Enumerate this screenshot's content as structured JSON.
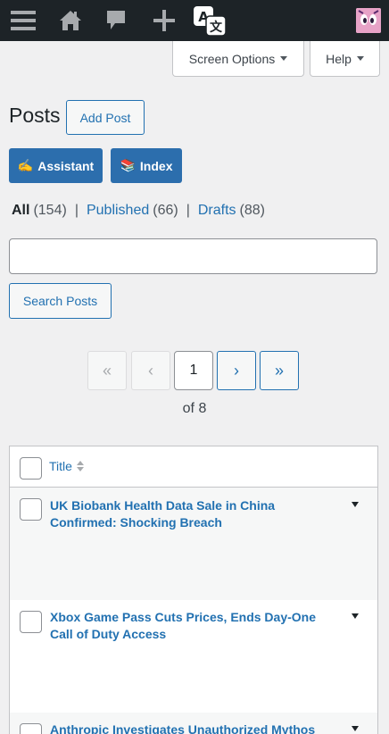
{
  "adminbar": {
    "icons": [
      "menu-icon",
      "home-icon",
      "comments-icon",
      "plus-icon",
      "translate-icon",
      "avatar"
    ]
  },
  "screen_meta": {
    "screen_options_label": "Screen Options",
    "help_label": "Help"
  },
  "page": {
    "title": "Posts",
    "add_post_label": "Add Post",
    "assistant_label": "Assistant",
    "assistant_emoji": "✍️",
    "index_label": "Index",
    "index_emoji": "📚"
  },
  "filters": {
    "all_label": "All",
    "all_count": "(154)",
    "published_label": "Published",
    "published_count": "(66)",
    "drafts_label": "Drafts",
    "drafts_count": "(88)",
    "separator": "|"
  },
  "search": {
    "value": "",
    "button_label": "Search Posts"
  },
  "pagination": {
    "first": "«",
    "prev": "‹",
    "current_page": "1",
    "next": "›",
    "last": "»",
    "of_text": "of 8"
  },
  "table": {
    "title_header": "Title",
    "rows": [
      {
        "title": "UK Biobank Health Data Sale in China Confirmed: Shocking Breach"
      },
      {
        "title": "Xbox Game Pass Cuts Prices, Ends Day-One Call of Duty Access"
      },
      {
        "title": "Anthropic Investigates Unauthorized Mythos"
      }
    ]
  },
  "colors": {
    "adminbar_bg": "#1d2327",
    "link": "#2271b1",
    "primary_btn": "#2c6ead",
    "page_bg": "#f0f0f1"
  }
}
